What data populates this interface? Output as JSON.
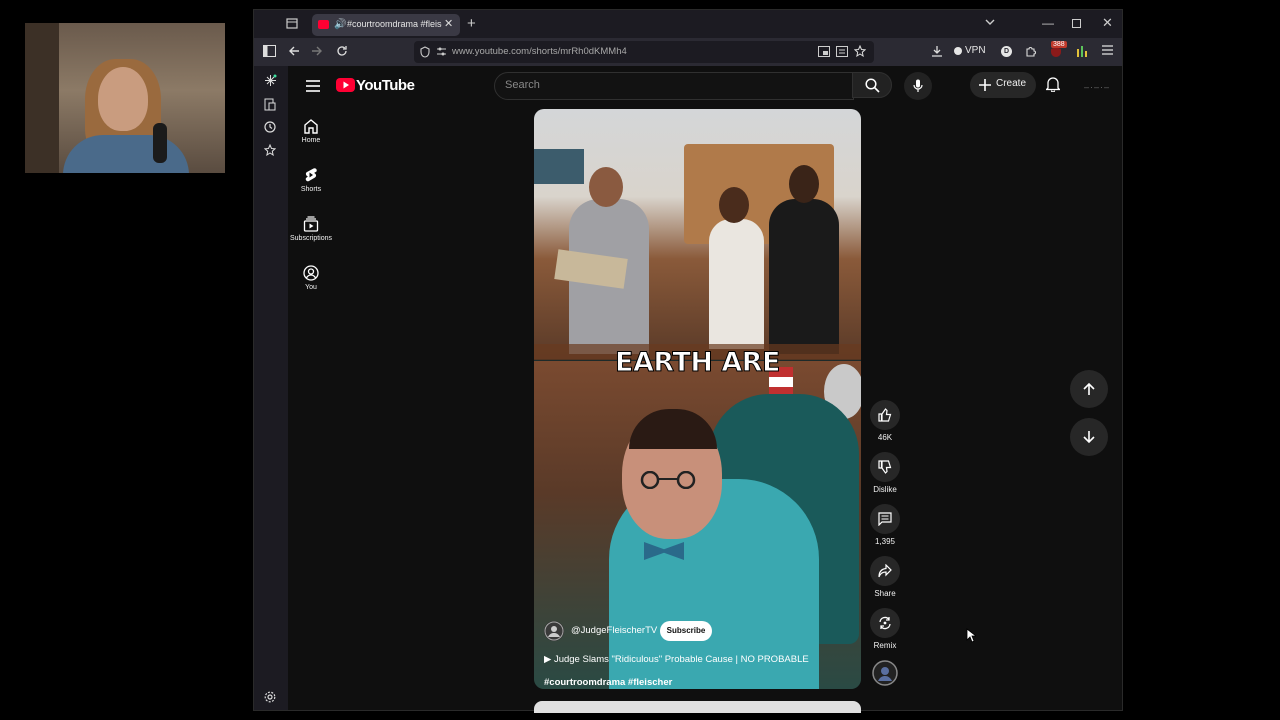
{
  "browser": {
    "tab_title": "#courtroomdrama #fleischer",
    "url": "www.youtube.com/shorts/mrRh0dKMMh4",
    "vpn_label": "VPN",
    "profile_letter": "D",
    "extension_badge": "388"
  },
  "youtube": {
    "logo_text": "YouTube",
    "search_placeholder": "Search",
    "create_label": "Create",
    "guide": [
      {
        "label": "Home",
        "icon": "home-icon"
      },
      {
        "label": "Shorts",
        "icon": "shorts-icon"
      },
      {
        "label": "Subscriptions",
        "icon": "subscriptions-icon"
      },
      {
        "label": "You",
        "icon": "you-icon"
      }
    ]
  },
  "short": {
    "caption_overlay": "EARTH ARE",
    "channel_handle": "@JudgeFleischerTV",
    "subscribe_label": "Subscribe",
    "title": "Judge Slams \"Ridiculous\" Probable Cause | NO PROBABLE",
    "tags": "#courtroomdrama #fleischer",
    "progress_fraction": 0.06,
    "actions": {
      "like_count": "46K",
      "dislike_label": "Dislike",
      "comment_count": "1,395",
      "share_label": "Share",
      "remix_label": "Remix"
    }
  },
  "colors": {
    "youtube_red": "#ff0033",
    "background": "#0f0f0f",
    "button_bg": "#272727"
  }
}
